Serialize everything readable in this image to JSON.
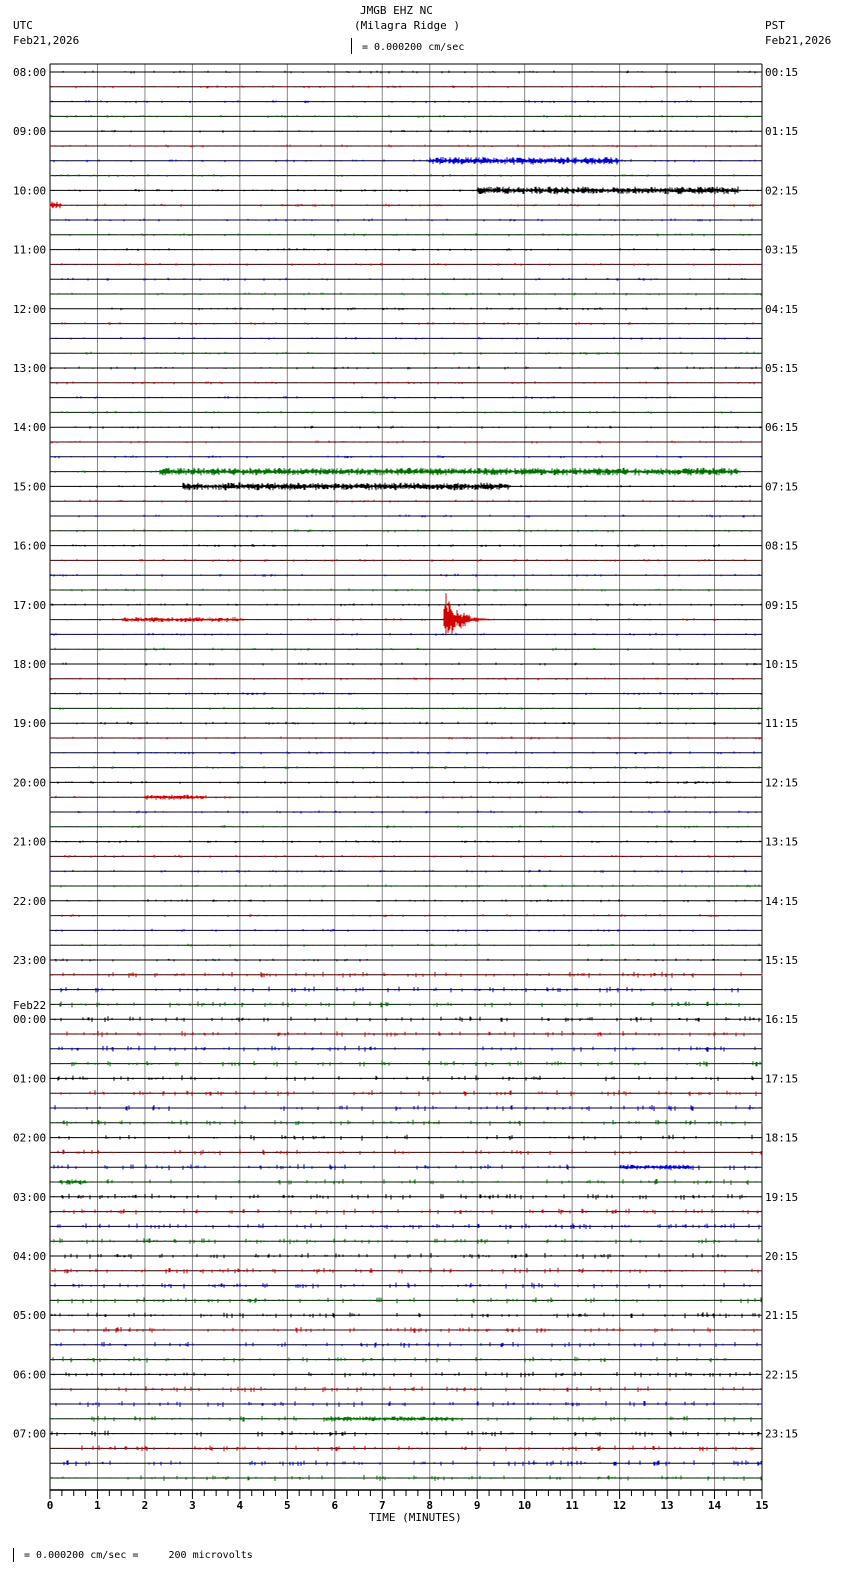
{
  "header": {
    "station": "JMGB EHZ NC",
    "location": "(Milagra Ridge )",
    "scale": "= 0.000200 cm/sec",
    "left_tz": "UTC",
    "left_date": "Feb21,2026",
    "right_tz": "PST",
    "right_date": "Feb21,2026"
  },
  "footer": {
    "scale": "= 0.000200 cm/sec =     200 microvolts"
  },
  "chart_data": {
    "type": "helicorder",
    "traces_per_hour": 4,
    "trace_colors": [
      "#000000",
      "#d00000",
      "#0000d0",
      "#007000"
    ],
    "left_labels": [
      "08:00",
      "09:00",
      "10:00",
      "11:00",
      "12:00",
      "13:00",
      "14:00",
      "15:00",
      "16:00",
      "17:00",
      "18:00",
      "19:00",
      "20:00",
      "21:00",
      "22:00",
      "23:00",
      "00:00",
      "01:00",
      "02:00",
      "03:00",
      "04:00",
      "05:00",
      "06:00",
      "07:00"
    ],
    "date_change": {
      "label": "Feb22",
      "at_hour_index": 16
    },
    "right_labels": [
      "00:15",
      "01:15",
      "02:15",
      "03:15",
      "04:15",
      "05:15",
      "06:15",
      "07:15",
      "08:15",
      "09:15",
      "10:15",
      "11:15",
      "12:15",
      "13:15",
      "14:15",
      "15:15",
      "16:15",
      "17:15",
      "18:15",
      "19:15",
      "20:15",
      "21:15",
      "22:15",
      "23:15"
    ],
    "xlabel": "TIME (MINUTES)",
    "xticks": [
      "0",
      "1",
      "2",
      "3",
      "4",
      "5",
      "6",
      "7",
      "8",
      "9",
      "10",
      "11",
      "12",
      "13",
      "14",
      "15"
    ],
    "xlim": [
      0,
      15
    ],
    "events": [
      {
        "trace": 6,
        "start": 8.0,
        "end": 12.0,
        "amp": 3
      },
      {
        "trace": 8,
        "start": 9.0,
        "end": 14.5,
        "amp": 3
      },
      {
        "trace": 9,
        "start": 0.0,
        "end": 0.25,
        "amp": 3
      },
      {
        "trace": 27,
        "start": 2.3,
        "end": 14.5,
        "amp": 3
      },
      {
        "trace": 28,
        "start": 2.8,
        "end": 9.7,
        "amp": 3
      },
      {
        "trace": 37,
        "start": 1.5,
        "end": 4.0,
        "amp": 2
      },
      {
        "trace": 37,
        "start": 8.3,
        "end": 9.5,
        "amp": 22,
        "quake": true
      },
      {
        "trace": 49,
        "start": 2.0,
        "end": 3.3,
        "amp": 2
      },
      {
        "trace": 74,
        "start": 12.0,
        "end": 13.5,
        "amp": 2
      },
      {
        "trace": 75,
        "start": 0.2,
        "end": 0.8,
        "amp": 2
      },
      {
        "trace": 91,
        "start": 5.8,
        "end": 8.6,
        "amp": 2
      }
    ]
  }
}
